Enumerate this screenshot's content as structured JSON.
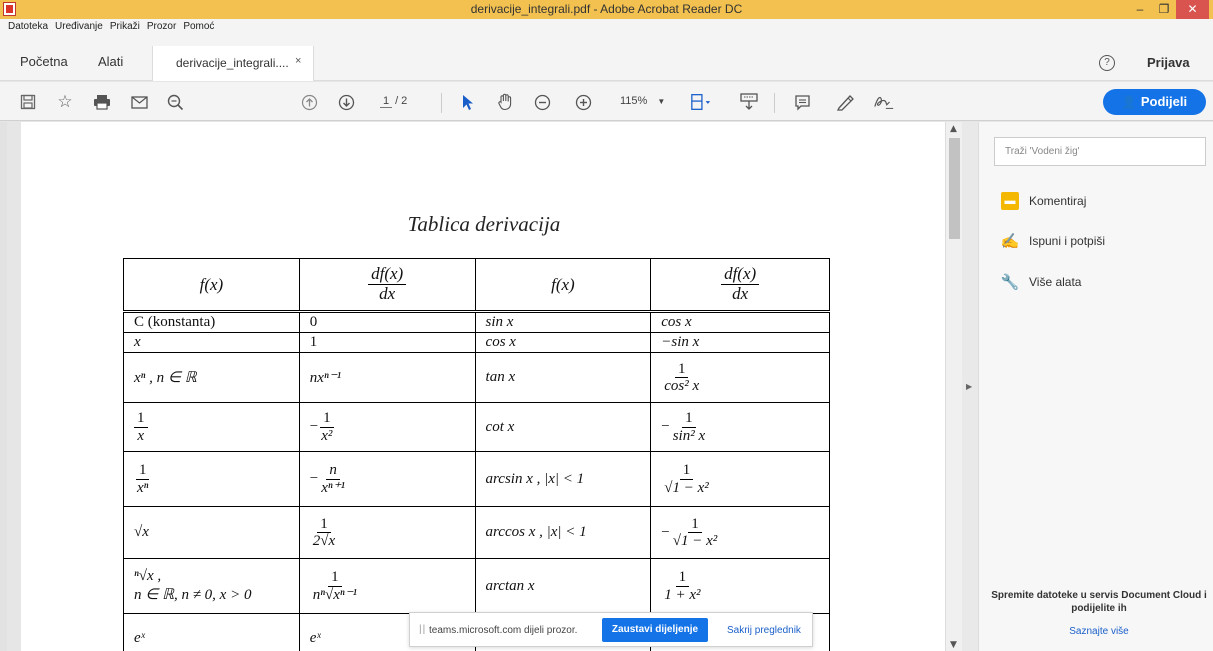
{
  "window": {
    "title": "derivacije_integrali.pdf - Adobe Acrobat Reader DC",
    "minimize": "–",
    "maximize": "❐",
    "close": "✕"
  },
  "menu": [
    "Datoteka",
    "Uređivanje",
    "Prikaži",
    "Prozor",
    "Pomoć"
  ],
  "tabs": {
    "home": "Početna",
    "tools": "Alati",
    "document": "derivacije_integrali....",
    "close": "×",
    "help": "?",
    "login": "Prijava"
  },
  "toolbar": {
    "page_current": "1",
    "page_total": "/ 2",
    "zoom": "115%",
    "share_label": "Podijeli"
  },
  "document": {
    "title": "Tablica derivacija",
    "headers": [
      "f(x)",
      "df(x)",
      "dx",
      "f(x)",
      "df(x)",
      "dx"
    ],
    "rows": [
      [
        "C  (konstanta)",
        "0",
        "sin x",
        "cos x"
      ],
      [
        "x",
        "1",
        "cos x",
        "−sin x"
      ],
      [
        "xⁿ ,  n ∈ ℝ",
        "nxⁿ⁻¹",
        "tan x",
        "1",
        "cos² x"
      ],
      [
        "1",
        "x",
        "−",
        "1",
        "x²",
        "cot x",
        "−",
        "1",
        "sin² x"
      ],
      [
        "1",
        "xⁿ",
        "−",
        "n",
        "xⁿ⁺¹",
        "arcsin x ,  |x| < 1",
        "1",
        "√1 − x²"
      ],
      [
        "√x",
        "1",
        "2√x",
        "arccos x ,  |x| < 1",
        "−",
        "1",
        "√1 − x²"
      ],
      [
        "ⁿ√x ,",
        "n ∈ ℝ, n ≠ 0, x > 0",
        "1",
        "nⁿ√xⁿ⁻¹",
        "arctan x",
        "1",
        "1 + x²"
      ],
      [
        "eˣ",
        "eˣ"
      ]
    ]
  },
  "right_panel": {
    "search_placeholder": "Traži 'Vodeni žig'",
    "tools": [
      "Komentiraj",
      "Ispuni i potpiši",
      "Više alata"
    ],
    "promo": "Spremite datoteke u servis Document Cloud i podijelite ih",
    "learn_more": "Saznajte više"
  },
  "share_notice": {
    "message": "teams.microsoft.com dijeli prozor.",
    "stop": "Zaustavi dijeljenje",
    "hide": "Sakrij preglednik"
  },
  "colors": {
    "titlebar": "#f2c150",
    "accent": "#1473e6",
    "close": "#d9534f"
  }
}
